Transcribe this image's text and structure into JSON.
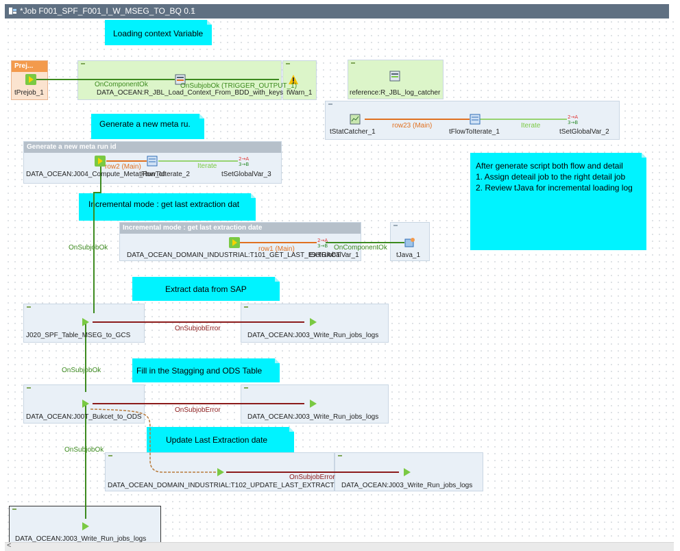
{
  "tab": {
    "title": "*Job F001_SPF_F001_I_W_MSEG_TO_BQ 0.1",
    "close": "×"
  },
  "notes": {
    "loading": "Loading context Variable",
    "generate": "Generate a new meta ru.",
    "incremental": "Incremental mode : get last extraction dat",
    "extract": "Extract data from SAP",
    "fill": "Fill in the Stagging and ODS Table",
    "update": "Update Last Extraction date",
    "after_title": "After generate script both flow and detail",
    "after_1": "1. Assign deteail job to the right detail job",
    "after_2": "2. Review tJava for incremental loading log"
  },
  "subjob_headers": {
    "prejob": "Prej...",
    "generate": "Generate a new meta run id",
    "incremental": "Incremental mode : get last extraction date"
  },
  "components": {
    "tprejob": "tPrejob_1",
    "load_ctx": "DATA_OCEAN:R_JBL_Load_Context_From_BDD_with_keys",
    "twarn": "tWarn_1",
    "logcatcher": "reference:R_JBL_log_catcher",
    "tstatcatcher": "tStatCatcher_1",
    "tflowtoiterate": "tFlowToIterate_1",
    "tsetglobalvar2": "tSetGlobalVar_2",
    "compute_meta": "DATA_OCEAN:J004_Compute_Meta_Run_Id",
    "tflowtoiterate2": "tFlowToIterate_2",
    "tsetglobalvar3": "tSetGlobalVar_3",
    "t101": "DATA_OCEAN_DOMAIN_INDUSTRIAL:T101_GET_LAST_EXTRACT",
    "tsetglobalvar1": "tSetGlobalVar_1",
    "tjava": "tJava_1",
    "j020": "J020_SPF_Table_MSEG_to_GCS",
    "j003_a": "DATA_OCEAN:J003_Write_Run_jobs_logs",
    "j00x": "DATA_OCEAN:J00T_Bukcet_to_ODS",
    "j003_b": "DATA_OCEAN:J003_Write_Run_jobs_logs",
    "t102": "DATA_OCEAN_DOMAIN_INDUSTRIAL:T102_UPDATE_LAST_EXTRACT",
    "j003_c": "DATA_OCEAN:J003_Write_Run_jobs_logs",
    "j003_d": "DATA_OCEAN:J003_Write_Run_jobs_logs"
  },
  "links": {
    "oncomponentok_1": "OnComponentOk",
    "onsubjobok_trigger": "OnSubjobOk (TRIGGER_OUTPUT_1)",
    "row23": "row23 (Main)",
    "iterate_1": "Iterate",
    "row2": "row2 (Main)",
    "iterate_2": "Iterate",
    "row1": "row1 (Main)",
    "oncomponentok_2": "OnComponentOk",
    "onsubjobok_1": "OnSubjobOk",
    "onsubjoberror_1": "OnSubjobError",
    "onsubjobok_2": "OnSubjobOk",
    "onsubjoberror_2": "OnSubjobError",
    "onsubjobok_3": "OnSubjobOk",
    "onsubjoberror_3": "OnSubjobError"
  },
  "colors": {
    "tab": "#5f7082",
    "note": "#00f3ff",
    "ok_link": "#3c8a1e",
    "err_link": "#8b1a1a",
    "main_link": "#e07020"
  },
  "scrollbar": {
    "left_arrow": "<"
  }
}
